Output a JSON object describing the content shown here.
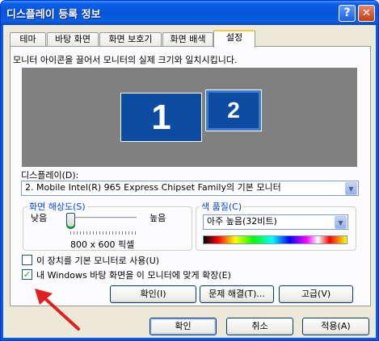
{
  "window": {
    "title": "디스플레이 등록 정보",
    "help_icon": "?",
    "close_icon": "✕"
  },
  "tabs": [
    "테마",
    "바탕 화면",
    "화면 보호기",
    "화면 배색",
    "설정"
  ],
  "settings": {
    "description": "모니터 아이콘을 끌어서 모니터의 실제 크기와 일치시킵니다.",
    "monitors": [
      "1",
      "2"
    ],
    "display_label": "디스플레이(D):",
    "display_value": "2. Mobile Intel(R) 965 Express Chipset Family의 기본 모니터",
    "resolution": {
      "title": "화면 해상도(S)",
      "low": "낮음",
      "high": "높음",
      "value": "800 x 600 픽셀",
      "slider_position": 0
    },
    "color_quality": {
      "title": "색 품질(C)",
      "value": "아주 높음(32비트)"
    },
    "checkbox_primary": {
      "label": "이 장치를 기본 모니터로 사용(U)",
      "checked": false
    },
    "checkbox_extend": {
      "label": "내 Windows 바탕 화면을 이 모니터에 맞게 확장(E)",
      "checked": true
    },
    "identify_label": "확인(I)",
    "troubleshoot_label": "문제 해결(T)...",
    "advanced_label": "고급(V)"
  },
  "footer": {
    "ok_label": "확인",
    "cancel_label": "취소",
    "apply_label": "적용(A)"
  },
  "colors": {
    "title_bar": "#0755d9",
    "monitor_fill": "#0c4da2",
    "monitor_background": "#808080",
    "annotation_arrow": "#e02020",
    "group_title": "#0046d5"
  }
}
